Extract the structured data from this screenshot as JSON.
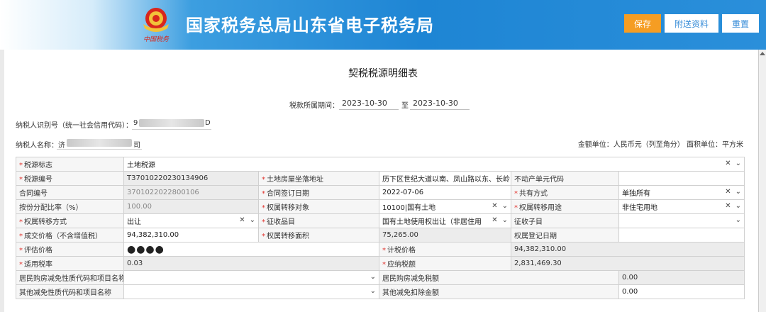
{
  "header": {
    "site_title": "国家税务总局山东省电子税务局",
    "emblem_caption": "中国税务",
    "save_label": "保存",
    "attach_label": "附送资料",
    "reset_label": "重置"
  },
  "page_title": "契税税源明细表",
  "period": {
    "label": "税款所属期间：",
    "start": "2023-10-30",
    "to": "至",
    "end": "2023-10-30"
  },
  "taxpayer": {
    "id_label": "纳税人识别号（统一社会信用代码）：",
    "id_visible_start": "9",
    "id_visible_end": "D",
    "name_label": "纳税人名称：",
    "name_visible_start": "济",
    "name_visible_end": "司"
  },
  "units": "金额单位：人民币元（列至角分）  面积单位：平方米",
  "form": {
    "r1": {
      "l1": "税源标志",
      "v1": "土地税源"
    },
    "r2": {
      "l1": "税源编号",
      "v1": "T37010220230134906",
      "l2": "土地房屋坐落地址",
      "v2": "历下区世纪大道以南、凤山路以东、长岭山",
      "l3": "不动产单元代码",
      "v3": ""
    },
    "r3": {
      "l1": "合同编号",
      "v1": "3701022022800106",
      "l2": "合同签订日期",
      "v2": "2022-07-06",
      "l3": "共有方式",
      "v3": "单独所有"
    },
    "r4": {
      "l1": "按份分配比率（%）",
      "v1": "100.00",
      "l2": "权属转移对象",
      "v2": "10100|国有土地",
      "l3": "权属转移用途",
      "v3": "非住宅用地"
    },
    "r5": {
      "l1": "权属转移方式",
      "v1": "出让",
      "l2": "征收品目",
      "v2": "国有土地使用权出让（非居住用",
      "l3": "征收子目",
      "v3": ""
    },
    "r6": {
      "l1": "成交价格（不含增值税）",
      "v1": "94,382,310.00",
      "l2": "权属转移面积",
      "v2": "75,265.00",
      "l3": "权属登记日期",
      "v3": ""
    },
    "r7": {
      "l1": "评估价格",
      "v1": "●●●●",
      "l2": "计税价格",
      "v2": "94,382,310.00"
    },
    "r8": {
      "l1": "适用税率",
      "v1": "0.03",
      "l2": "应纳税额",
      "v2": "2,831,469.30"
    },
    "r9": {
      "l1": "居民购房减免性质代码和项目名称",
      "v1": "",
      "l2": "居民购房减免税额",
      "v2": "0.00"
    },
    "r10": {
      "l1": "其他减免性质代码和项目名称",
      "v1": "",
      "l2": "其他减免扣除金额",
      "v2": "0.00"
    }
  },
  "icons": {
    "clear": "✕",
    "dropdown": "⌄"
  },
  "colors": {
    "header_blue": "#1e85d4",
    "save_orange": "#f59d23",
    "required_red": "#e0302a",
    "readonly_gray": "#ececec"
  }
}
